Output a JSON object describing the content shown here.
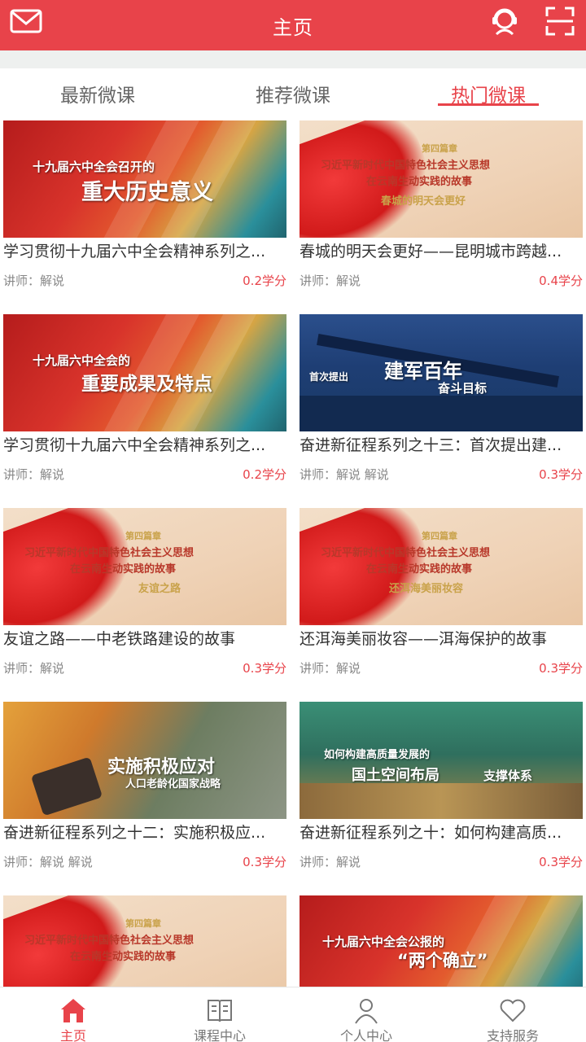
{
  "header": {
    "title": "主页",
    "left_icon": "mail-icon",
    "right_icons": [
      "customer-service-icon",
      "scan-icon"
    ]
  },
  "tabs": [
    {
      "label": "最新微课",
      "active": false
    },
    {
      "label": "推荐微课",
      "active": false
    },
    {
      "label": "热门微课",
      "active": true
    }
  ],
  "courses": [
    {
      "title": "学习贯彻十九届六中全会精神系列之...",
      "lecturer": "讲师：解说",
      "credit": "0.2学分",
      "thumb_text": [
        "十九届六中全会召开的",
        "重大历史意义"
      ]
    },
    {
      "title": "春城的明天会更好——昆明城市跨越...",
      "lecturer": "讲师：解说",
      "credit": "0.4学分",
      "thumb_text": [
        "第四篇章",
        "习近平新时代中国特色社会主义思想",
        "在云南生动实践的故事",
        "春城的明天会更好"
      ]
    },
    {
      "title": "学习贯彻十九届六中全会精神系列之...",
      "lecturer": "讲师：解说",
      "credit": "0.2学分",
      "thumb_text": [
        "十九届六中全会的",
        "重要成果及特点"
      ]
    },
    {
      "title": "奋进新征程系列之十三：首次提出建...",
      "lecturer": "讲师：解说 解说",
      "credit": "0.3学分",
      "thumb_text": [
        "首次提出",
        "建军百年",
        "奋斗目标"
      ]
    },
    {
      "title": "友谊之路——中老铁路建设的故事",
      "lecturer": "讲师：解说",
      "credit": "0.3学分",
      "thumb_text": [
        "第四篇章",
        "习近平新时代中国特色社会主义思想",
        "在云南生动实践的故事",
        "友谊之路"
      ]
    },
    {
      "title": "还洱海美丽妆容——洱海保护的故事",
      "lecturer": "讲师：解说",
      "credit": "0.3学分",
      "thumb_text": [
        "第四篇章",
        "习近平新时代中国特色社会主义思想",
        "在云南生动实践的故事",
        "还洱海美丽妆容"
      ]
    },
    {
      "title": "奋进新征程系列之十二：实施积极应...",
      "lecturer": "讲师：解说 解说",
      "credit": "0.3学分",
      "thumb_text": [
        "实施积极应对",
        "人口老龄化国家战略"
      ]
    },
    {
      "title": "奋进新征程系列之十：如何构建高质...",
      "lecturer": "讲师：解说",
      "credit": "0.3学分",
      "thumb_text": [
        "如何构建高质量发展的",
        "国土空间布局",
        "支撑体系"
      ]
    },
    {
      "title": "",
      "lecturer": "",
      "credit": "",
      "thumb_text": [
        "第四篇章",
        "习近平新时代中国特色社会主义思想",
        "在云南生动实践的故事"
      ]
    },
    {
      "title": "",
      "lecturer": "",
      "credit": "",
      "thumb_text": [
        "十九届六中全会公报的",
        "“两个确立”"
      ]
    }
  ],
  "bottom_nav": [
    {
      "label": "主页",
      "icon": "home-icon",
      "active": true
    },
    {
      "label": "课程中心",
      "icon": "book-icon",
      "active": false
    },
    {
      "label": "个人中心",
      "icon": "person-icon",
      "active": false
    },
    {
      "label": "支持服务",
      "icon": "heart-icon",
      "active": false
    }
  ],
  "colors": {
    "accent": "#e8434a",
    "header_bg": "#e8434a",
    "credit": "#e8434a"
  }
}
